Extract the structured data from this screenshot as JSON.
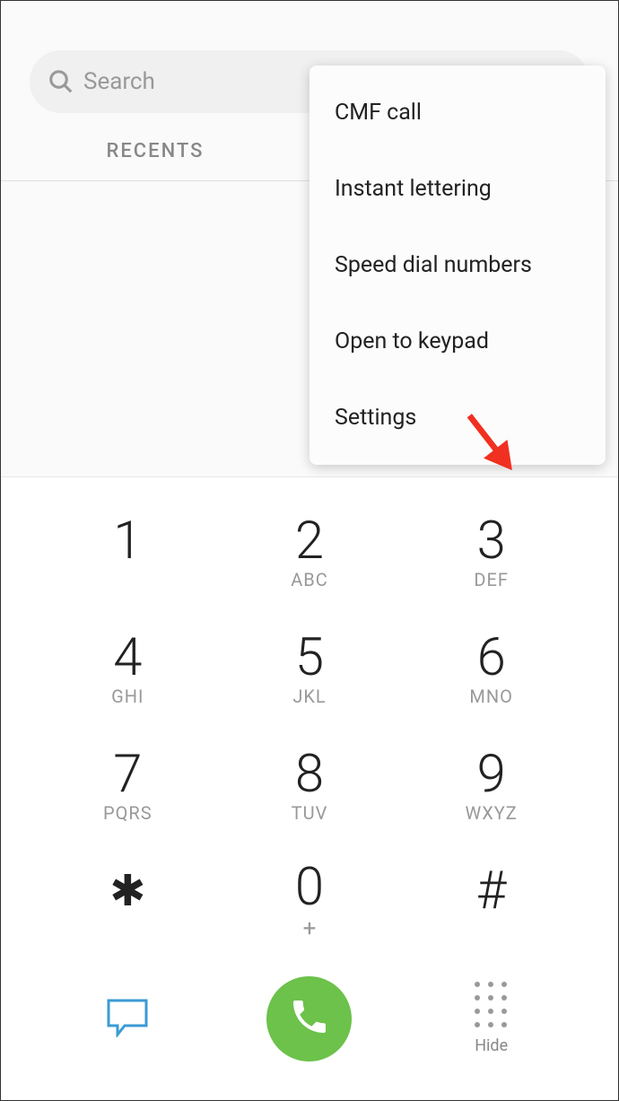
{
  "search": {
    "placeholder": "Search"
  },
  "tabs": {
    "recents": "RECENTS"
  },
  "menu": {
    "items": [
      "CMF call",
      "Instant lettering",
      "Speed dial numbers",
      "Open to keypad",
      "Settings"
    ]
  },
  "keypad": {
    "k1": {
      "digit": "1",
      "letters": ""
    },
    "k2": {
      "digit": "2",
      "letters": "ABC"
    },
    "k3": {
      "digit": "3",
      "letters": "DEF"
    },
    "k4": {
      "digit": "4",
      "letters": "GHI"
    },
    "k5": {
      "digit": "5",
      "letters": "JKL"
    },
    "k6": {
      "digit": "6",
      "letters": "MNO"
    },
    "k7": {
      "digit": "7",
      "letters": "PQRS"
    },
    "k8": {
      "digit": "8",
      "letters": "TUV"
    },
    "k9": {
      "digit": "9",
      "letters": "WXYZ"
    },
    "kstar": {
      "digit": "✱",
      "letters": ""
    },
    "k0": {
      "digit": "0",
      "plus": "+"
    },
    "khash": {
      "digit": "#",
      "letters": ""
    }
  },
  "actions": {
    "hide": "Hide"
  }
}
